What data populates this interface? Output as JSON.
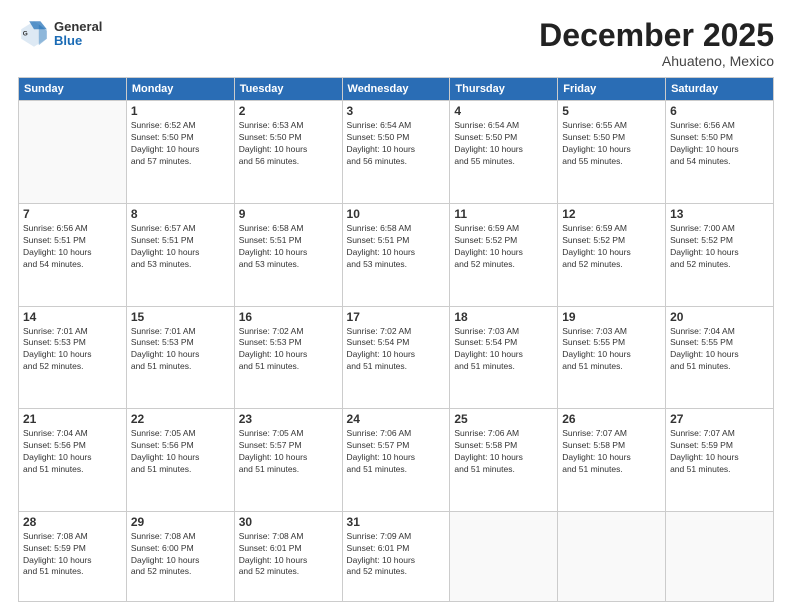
{
  "header": {
    "logo_general": "General",
    "logo_blue": "Blue",
    "month_title": "December 2025",
    "location": "Ahuateno, Mexico"
  },
  "calendar": {
    "headers": [
      "Sunday",
      "Monday",
      "Tuesday",
      "Wednesday",
      "Thursday",
      "Friday",
      "Saturday"
    ],
    "weeks": [
      [
        {
          "day": "",
          "info": ""
        },
        {
          "day": "1",
          "info": "Sunrise: 6:52 AM\nSunset: 5:50 PM\nDaylight: 10 hours\nand 57 minutes."
        },
        {
          "day": "2",
          "info": "Sunrise: 6:53 AM\nSunset: 5:50 PM\nDaylight: 10 hours\nand 56 minutes."
        },
        {
          "day": "3",
          "info": "Sunrise: 6:54 AM\nSunset: 5:50 PM\nDaylight: 10 hours\nand 56 minutes."
        },
        {
          "day": "4",
          "info": "Sunrise: 6:54 AM\nSunset: 5:50 PM\nDaylight: 10 hours\nand 55 minutes."
        },
        {
          "day": "5",
          "info": "Sunrise: 6:55 AM\nSunset: 5:50 PM\nDaylight: 10 hours\nand 55 minutes."
        },
        {
          "day": "6",
          "info": "Sunrise: 6:56 AM\nSunset: 5:50 PM\nDaylight: 10 hours\nand 54 minutes."
        }
      ],
      [
        {
          "day": "7",
          "info": "Sunrise: 6:56 AM\nSunset: 5:51 PM\nDaylight: 10 hours\nand 54 minutes."
        },
        {
          "day": "8",
          "info": "Sunrise: 6:57 AM\nSunset: 5:51 PM\nDaylight: 10 hours\nand 53 minutes."
        },
        {
          "day": "9",
          "info": "Sunrise: 6:58 AM\nSunset: 5:51 PM\nDaylight: 10 hours\nand 53 minutes."
        },
        {
          "day": "10",
          "info": "Sunrise: 6:58 AM\nSunset: 5:51 PM\nDaylight: 10 hours\nand 53 minutes."
        },
        {
          "day": "11",
          "info": "Sunrise: 6:59 AM\nSunset: 5:52 PM\nDaylight: 10 hours\nand 52 minutes."
        },
        {
          "day": "12",
          "info": "Sunrise: 6:59 AM\nSunset: 5:52 PM\nDaylight: 10 hours\nand 52 minutes."
        },
        {
          "day": "13",
          "info": "Sunrise: 7:00 AM\nSunset: 5:52 PM\nDaylight: 10 hours\nand 52 minutes."
        }
      ],
      [
        {
          "day": "14",
          "info": "Sunrise: 7:01 AM\nSunset: 5:53 PM\nDaylight: 10 hours\nand 52 minutes."
        },
        {
          "day": "15",
          "info": "Sunrise: 7:01 AM\nSunset: 5:53 PM\nDaylight: 10 hours\nand 51 minutes."
        },
        {
          "day": "16",
          "info": "Sunrise: 7:02 AM\nSunset: 5:53 PM\nDaylight: 10 hours\nand 51 minutes."
        },
        {
          "day": "17",
          "info": "Sunrise: 7:02 AM\nSunset: 5:54 PM\nDaylight: 10 hours\nand 51 minutes."
        },
        {
          "day": "18",
          "info": "Sunrise: 7:03 AM\nSunset: 5:54 PM\nDaylight: 10 hours\nand 51 minutes."
        },
        {
          "day": "19",
          "info": "Sunrise: 7:03 AM\nSunset: 5:55 PM\nDaylight: 10 hours\nand 51 minutes."
        },
        {
          "day": "20",
          "info": "Sunrise: 7:04 AM\nSunset: 5:55 PM\nDaylight: 10 hours\nand 51 minutes."
        }
      ],
      [
        {
          "day": "21",
          "info": "Sunrise: 7:04 AM\nSunset: 5:56 PM\nDaylight: 10 hours\nand 51 minutes."
        },
        {
          "day": "22",
          "info": "Sunrise: 7:05 AM\nSunset: 5:56 PM\nDaylight: 10 hours\nand 51 minutes."
        },
        {
          "day": "23",
          "info": "Sunrise: 7:05 AM\nSunset: 5:57 PM\nDaylight: 10 hours\nand 51 minutes."
        },
        {
          "day": "24",
          "info": "Sunrise: 7:06 AM\nSunset: 5:57 PM\nDaylight: 10 hours\nand 51 minutes."
        },
        {
          "day": "25",
          "info": "Sunrise: 7:06 AM\nSunset: 5:58 PM\nDaylight: 10 hours\nand 51 minutes."
        },
        {
          "day": "26",
          "info": "Sunrise: 7:07 AM\nSunset: 5:58 PM\nDaylight: 10 hours\nand 51 minutes."
        },
        {
          "day": "27",
          "info": "Sunrise: 7:07 AM\nSunset: 5:59 PM\nDaylight: 10 hours\nand 51 minutes."
        }
      ],
      [
        {
          "day": "28",
          "info": "Sunrise: 7:08 AM\nSunset: 5:59 PM\nDaylight: 10 hours\nand 51 minutes."
        },
        {
          "day": "29",
          "info": "Sunrise: 7:08 AM\nSunset: 6:00 PM\nDaylight: 10 hours\nand 52 minutes."
        },
        {
          "day": "30",
          "info": "Sunrise: 7:08 AM\nSunset: 6:01 PM\nDaylight: 10 hours\nand 52 minutes."
        },
        {
          "day": "31",
          "info": "Sunrise: 7:09 AM\nSunset: 6:01 PM\nDaylight: 10 hours\nand 52 minutes."
        },
        {
          "day": "",
          "info": ""
        },
        {
          "day": "",
          "info": ""
        },
        {
          "day": "",
          "info": ""
        }
      ]
    ]
  }
}
